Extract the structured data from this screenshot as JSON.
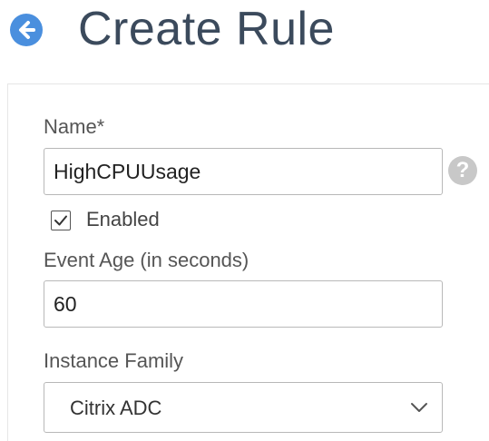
{
  "header": {
    "back_icon": "arrow-left-circle-icon",
    "title": "Create Rule"
  },
  "form": {
    "name": {
      "label": "Name*",
      "value": "HighCPUUsage",
      "help_icon": "question-mark-icon",
      "help_glyph": "?"
    },
    "enabled": {
      "label": "Enabled",
      "checked": true,
      "icon": "checkmark-icon"
    },
    "event_age": {
      "label": "Event Age (in seconds)",
      "value": "60"
    },
    "instance_family": {
      "label": "Instance Family",
      "selected": "Citrix ADC",
      "icon": "chevron-down-icon"
    }
  },
  "colors": {
    "accent": "#4a8fde",
    "title": "#3b4a5c",
    "help_icon_bg": "#c8c8c8",
    "border": "#b8b8b8"
  }
}
